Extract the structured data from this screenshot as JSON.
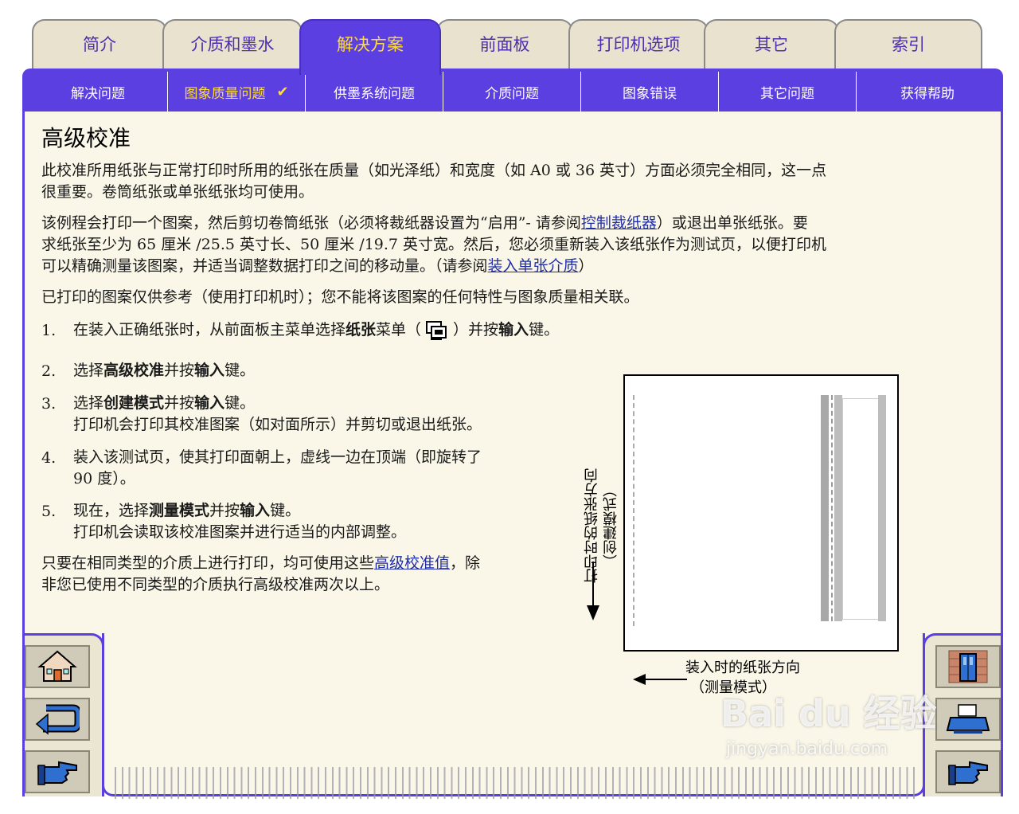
{
  "tabs": [
    {
      "label": "简介"
    },
    {
      "label": "介质和墨水"
    },
    {
      "label": "解决方案",
      "active": true
    },
    {
      "label": "前面板"
    },
    {
      "label": "打印机选项"
    },
    {
      "label": "其它"
    },
    {
      "label": "索引"
    }
  ],
  "subnav": [
    {
      "label": "解决问题"
    },
    {
      "label": "图象质量问题",
      "active": true,
      "check": "✔"
    },
    {
      "label": "供墨系统问题"
    },
    {
      "label": "介质问题"
    },
    {
      "label": "图象错误"
    },
    {
      "label": "其它问题"
    },
    {
      "label": "获得帮助"
    }
  ],
  "page": {
    "title": "高级校准",
    "p1_line1": "此校准所用纸张与正常打印时所用的纸张在质量（如光泽纸）和宽度（如 A0 或 36 英寸）方面必须完全相同，这一点",
    "p1_line2": "很重要。卷筒纸张或单张纸张均可使用。",
    "p2_line1_a": "该例程会打印一个图案，然后剪切卷筒纸张（必须将裁纸器设置为“启用”- 请参阅",
    "p2_line1_link": "控制裁纸器",
    "p2_line1_b": "）或退出单张纸张。要",
    "p2_line2": "求纸张至少为 65 厘米 /25.5 英寸长、50 厘米 /19.7 英寸宽。然后，您必须重新装入该纸张作为测试页，以便打印机",
    "p2_line3_a": "可以精确测量该图案，并适当调整数据打印之间的移动量。（请参阅",
    "p2_line3_link": "装入单张介质",
    "p2_line3_b": "）",
    "p3": "已打印的图案仅供参考（使用打印机时）；您不能将该图案的任何特性与图象质量相关联。",
    "steps": [
      {
        "num": "1.",
        "a": "在装入正确纸张时，从前面板主菜单选择",
        "b1": "纸张",
        "c": "菜单（",
        "d": "）并按",
        "b2": "输入",
        "e": "键。"
      },
      {
        "num": "2.",
        "a": "选择",
        "b1": "高级校准",
        "c": "并按",
        "b2": "输入",
        "e": "键。"
      },
      {
        "num": "3.",
        "a": "选择",
        "b1": "创建模式",
        "c": "并按",
        "b2": "输入",
        "e": "键。",
        "line2": "打印机会打印其校准图案（如对面所示）并剪切或退出纸张。"
      },
      {
        "num": "4.",
        "line1": "装入该测试页，使其打印面朝上，虚线一边在顶端（即旋转了",
        "line2": "90 度）。"
      },
      {
        "num": "5.",
        "a": "现在，选择",
        "b1": "测量模式",
        "c": "并按",
        "b2": "输入",
        "e": "键。",
        "line2": "打印机会读取该校准图案并进行适当的内部调整。"
      }
    ],
    "closing_a": "只要在相同类型的介质上进行打印，均可使用这些",
    "closing_link": "高级校准值",
    "closing_b": "，除",
    "closing_line2": "非您已使用不同类型的介质执行高级校准两次以上。"
  },
  "figure": {
    "vertical_label_1": "打印时的纸张方向",
    "vertical_label_2": "（创建模式）",
    "bottom_label_1": "装入时的纸张方向",
    "bottom_label_2": "（测量模式）"
  },
  "watermark": {
    "brand": "Bai du 经验",
    "url": "jingyan.baidu.com"
  },
  "icons": [
    "home-icon",
    "back-icon",
    "next-page-icon",
    "door-icon",
    "printer-icon",
    "pointing-hand-icon",
    "paper-menu-icon"
  ]
}
